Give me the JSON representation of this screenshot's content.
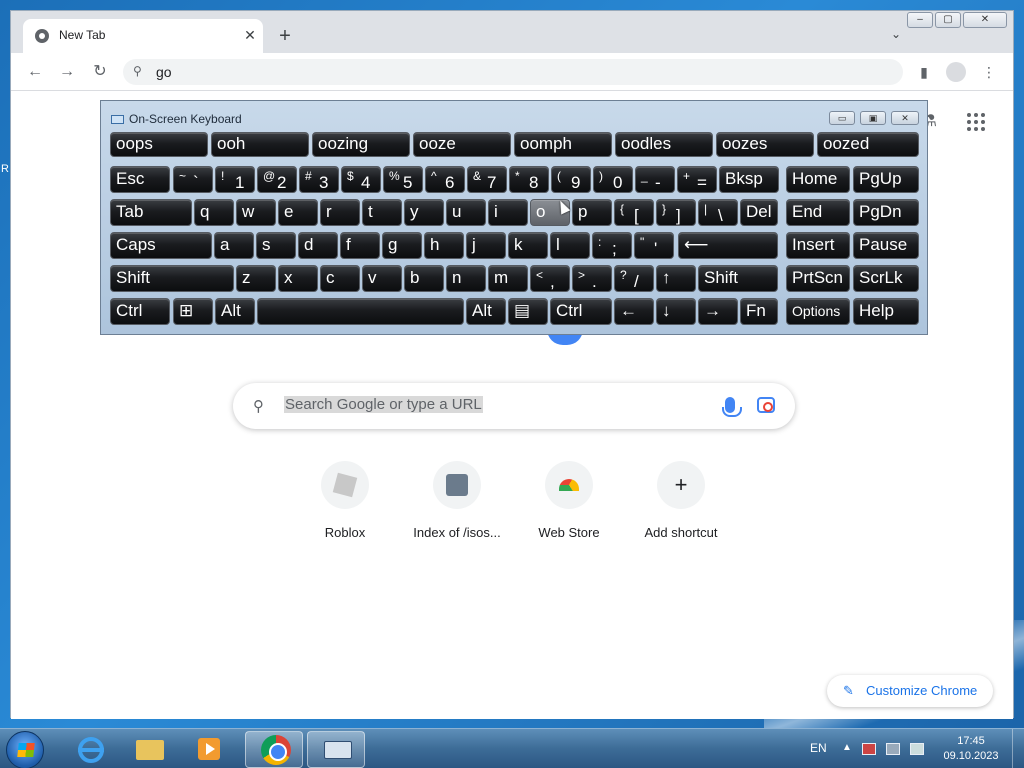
{
  "browser": {
    "tab_title": "New Tab",
    "tab_close": "✕",
    "new_tab": "+",
    "tab_search": "⌄",
    "window_buttons": [
      "–",
      "▢",
      "✕"
    ],
    "back": "←",
    "forward": "→",
    "reload": "↻",
    "omnibox_icon": "⚲",
    "omnibox_text": "go",
    "sidepanel": "▮",
    "menu": "⋮"
  },
  "newtab": {
    "search_placeholder": "Search Google or type a URL",
    "search_icon": "⚲",
    "labs_icon": "⚗",
    "shortcuts": [
      {
        "label": "Roblox"
      },
      {
        "label": "Index of /isos..."
      },
      {
        "label": "Web Store"
      },
      {
        "label": "Add shortcut",
        "glyph": "+"
      }
    ],
    "customize_label": "Customize Chrome",
    "customize_icon": "✎"
  },
  "osk": {
    "title": "On-Screen Keyboard",
    "window_buttons": [
      "▭",
      "▣",
      "✕"
    ],
    "predictions": [
      "oops",
      "ooh",
      "oozing",
      "ooze",
      "oomph",
      "oodles",
      "oozes",
      "oozed"
    ],
    "row1": [
      {
        "label": "Esc"
      },
      {
        "sub": "~",
        "main": "`"
      },
      {
        "sub": "!",
        "main": "1"
      },
      {
        "sub": "@",
        "main": "2"
      },
      {
        "sub": "#",
        "main": "3"
      },
      {
        "sub": "$",
        "main": "4"
      },
      {
        "sub": "%",
        "main": "5"
      },
      {
        "sub": "^",
        "main": "6"
      },
      {
        "sub": "&",
        "main": "7"
      },
      {
        "sub": "*",
        "main": "8"
      },
      {
        "sub": "(",
        "main": "9"
      },
      {
        "sub": ")",
        "main": "0"
      },
      {
        "sub": "_",
        "main": "-"
      },
      {
        "sub": "+",
        "main": "="
      },
      {
        "label": "Bksp"
      },
      {
        "label": "Home"
      },
      {
        "label": "PgUp"
      }
    ],
    "row2": [
      {
        "label": "Tab"
      },
      {
        "label": "q"
      },
      {
        "label": "w"
      },
      {
        "label": "e"
      },
      {
        "label": "r"
      },
      {
        "label": "t"
      },
      {
        "label": "y"
      },
      {
        "label": "u"
      },
      {
        "label": "i"
      },
      {
        "label": "o",
        "highlight": true
      },
      {
        "label": "p"
      },
      {
        "sub": "{",
        "main": "["
      },
      {
        "sub": "}",
        "main": "]"
      },
      {
        "sub": "|",
        "main": "\\"
      },
      {
        "label": "Del"
      },
      {
        "label": "End"
      },
      {
        "label": "PgDn"
      }
    ],
    "row3": [
      {
        "label": "Caps"
      },
      {
        "label": "a"
      },
      {
        "label": "s"
      },
      {
        "label": "d"
      },
      {
        "label": "f"
      },
      {
        "label": "g"
      },
      {
        "label": "h"
      },
      {
        "label": "j"
      },
      {
        "label": "k"
      },
      {
        "label": "l"
      },
      {
        "sub": ":",
        "main": ";"
      },
      {
        "sub": "\"",
        "main": "'"
      },
      {
        "label": "⟵"
      },
      {
        "label": "Insert"
      },
      {
        "label": "Pause"
      }
    ],
    "row4": [
      {
        "label": "Shift"
      },
      {
        "label": "z"
      },
      {
        "label": "x"
      },
      {
        "label": "c"
      },
      {
        "label": "v"
      },
      {
        "label": "b"
      },
      {
        "label": "n"
      },
      {
        "label": "m"
      },
      {
        "sub": "<",
        "main": ","
      },
      {
        "sub": ">",
        "main": "."
      },
      {
        "sub": "?",
        "main": "/"
      },
      {
        "label": "↑"
      },
      {
        "label": "Shift"
      },
      {
        "label": "PrtScn"
      },
      {
        "label": "ScrLk"
      }
    ],
    "row5": [
      {
        "label": "Ctrl"
      },
      {
        "label": "⊞"
      },
      {
        "label": "Alt"
      },
      {
        "label": ""
      },
      {
        "label": "Alt"
      },
      {
        "label": "▤"
      },
      {
        "label": "Ctrl"
      },
      {
        "label": "←"
      },
      {
        "label": "↓"
      },
      {
        "label": "→"
      },
      {
        "label": "Fn"
      },
      {
        "label": "Options"
      },
      {
        "label": "Help"
      }
    ]
  },
  "taskbar": {
    "language": "EN",
    "tray_arrow": "▲",
    "time": "17:45",
    "date": "09.10.2023"
  },
  "desktop": {
    "edge_text": "R"
  }
}
